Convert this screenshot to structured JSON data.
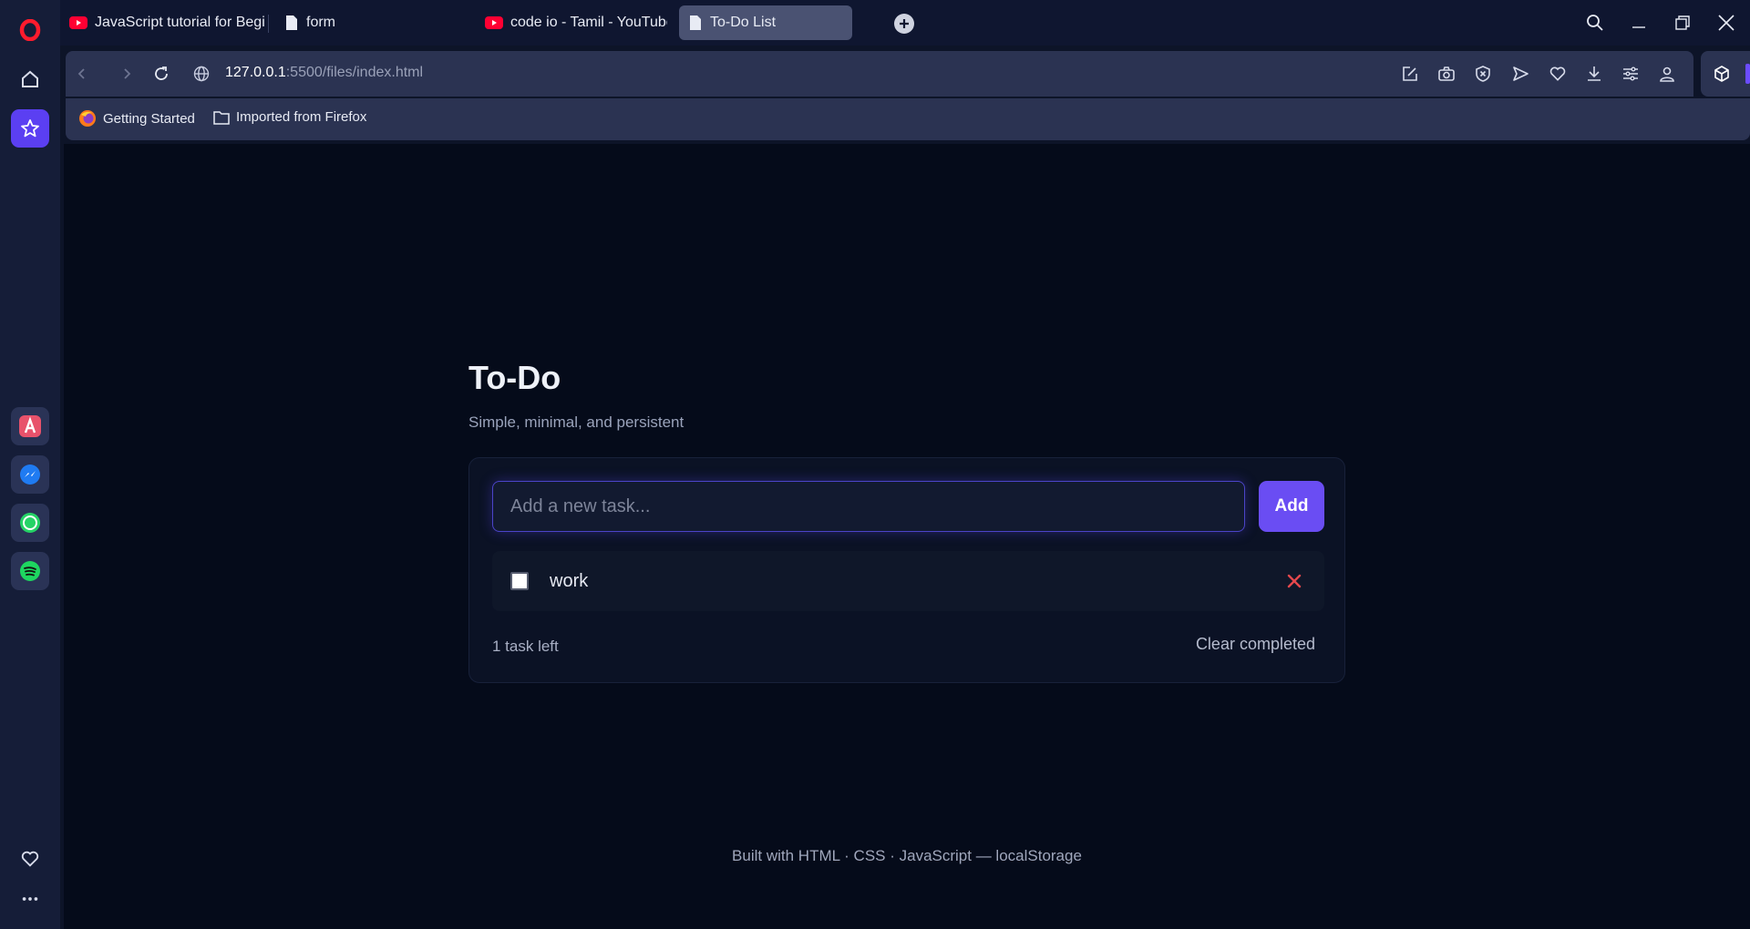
{
  "browser": {
    "tabs": [
      {
        "label": "JavaScript tutorial for Beginn",
        "icon": "youtube-icon"
      },
      {
        "label": "form",
        "icon": "file-icon"
      },
      {
        "label": "code io - Tamil - YouTube",
        "icon": "youtube-icon"
      },
      {
        "label": "To-Do List",
        "icon": "file-icon",
        "active": true
      }
    ],
    "url_host": "127.0.0.1",
    "url_path": ":5500/files/index.html",
    "bookmarks": [
      {
        "label": "Getting Started",
        "icon": "firefox-icon"
      },
      {
        "label": "Imported from Firefox",
        "icon": "folder-icon"
      }
    ],
    "sidebar_apps": [
      "aria-icon",
      "messenger-icon",
      "whatsapp-icon",
      "spotify-icon"
    ],
    "colors": {
      "accent": "#5b3ff2",
      "youtube": "#ff0033"
    }
  },
  "app": {
    "title": "To-Do",
    "subtitle": "Simple, minimal, and persistent",
    "input_placeholder": "Add a new task...",
    "add_label": "Add",
    "todos": [
      {
        "text": "work",
        "done": false
      }
    ],
    "count_text": "1 task left",
    "clear_label": "Clear completed",
    "footer": "Built with HTML · CSS · JavaScript — localStorage",
    "colors": {
      "accent": "#6a4df3",
      "delete": "#e5484d"
    }
  }
}
